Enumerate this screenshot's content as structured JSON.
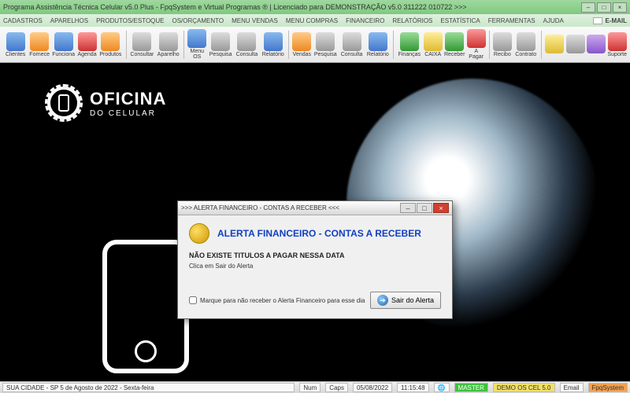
{
  "titlebar": {
    "text": "Programa Assistência Técnica Celular v5.0 Plus - FpqSystem e Virtual Programas ® | Licenciado para  DEMONSTRAÇÃO v5.0 311222 010722 >>>"
  },
  "menu": {
    "items": [
      "CADASTROS",
      "APARELHOS",
      "PRODUTOS/ESTOQUE",
      "OS/ORÇAMENTO",
      "MENU VENDAS",
      "MENU COMPRAS",
      "FINANCEIRO",
      "RELATÓRIOS",
      "ESTATÍSTICA",
      "FERRAMENTAS",
      "AJUDA"
    ],
    "email": "E-MAIL"
  },
  "toolbar": [
    {
      "label": "Clientes",
      "icon": "people-icon",
      "cls": "ic-blue"
    },
    {
      "label": "Fornece",
      "icon": "truck-icon",
      "cls": "ic-orange"
    },
    {
      "label": "Funciona",
      "icon": "person-icon",
      "cls": "ic-blue"
    },
    {
      "label": "Agenda",
      "icon": "calendar-icon",
      "cls": "ic-red"
    },
    {
      "label": "Produtos",
      "icon": "box-icon",
      "cls": "ic-orange",
      "sep": true
    },
    {
      "label": "Consultar",
      "icon": "search-icon",
      "cls": "ic-gray"
    },
    {
      "label": "Aparelho",
      "icon": "phone-icon",
      "cls": "ic-gray",
      "sep": true
    },
    {
      "label": "Menu OS",
      "icon": "clipboard-icon",
      "cls": "ic-blue"
    },
    {
      "label": "Pesquisa",
      "icon": "magnifier-icon",
      "cls": "ic-gray"
    },
    {
      "label": "Consulta",
      "icon": "list-icon",
      "cls": "ic-gray"
    },
    {
      "label": "Relatório",
      "icon": "report-icon",
      "cls": "ic-blue",
      "sep": true
    },
    {
      "label": "Vendas",
      "icon": "cart-icon",
      "cls": "ic-orange"
    },
    {
      "label": "Pesquisa",
      "icon": "magnifier-icon",
      "cls": "ic-gray"
    },
    {
      "label": "Consulta",
      "icon": "list-icon",
      "cls": "ic-gray"
    },
    {
      "label": "Relatório",
      "icon": "report-icon",
      "cls": "ic-blue",
      "sep": true
    },
    {
      "label": "Finanças",
      "icon": "money-icon",
      "cls": "ic-green"
    },
    {
      "label": "CAIXA",
      "icon": "cash-icon",
      "cls": "ic-yellow"
    },
    {
      "label": "Receber",
      "icon": "coin-in-icon",
      "cls": "ic-green"
    },
    {
      "label": "A Pagar",
      "icon": "coin-out-icon",
      "cls": "ic-red",
      "sep": true
    },
    {
      "label": "Recibo",
      "icon": "receipt-icon",
      "cls": "ic-gray"
    },
    {
      "label": "Contrato",
      "icon": "contract-icon",
      "cls": "ic-gray",
      "sep": true
    },
    {
      "label": "",
      "icon": "coin-icon",
      "cls": "ic-yellow"
    },
    {
      "label": "",
      "icon": "doc-icon",
      "cls": "ic-gray"
    },
    {
      "label": "",
      "icon": "tool-icon",
      "cls": "ic-purple"
    },
    {
      "label": "Suporte",
      "icon": "exit-icon",
      "cls": "ic-red"
    }
  ],
  "logo": {
    "line1": "OFICINA",
    "line2": "DO CELULAR"
  },
  "dialog": {
    "title": ">>> ALERTA FINANCEIRO - CONTAS A RECEBER <<<",
    "heading": "ALERTA FINANCEIRO - CONTAS A RECEBER",
    "msg1": "NÃO EXISTE TITULOS A PAGAR NESSA DATA",
    "msg2": "Clica em Sair do Alerta",
    "checkbox": "Marque para não receber o Alerta Financeiro para esse dia",
    "button": "Sair do Alerta"
  },
  "statusbar": {
    "location": "SUA CIDADE - SP  5 de Agosto de 2022 - Sexta-feira",
    "num": "Num",
    "caps": "Caps",
    "date": "05/08/2022",
    "time": "11:15:48",
    "master": "MASTER",
    "demo": "DEMO OS CEL 5.0",
    "email": "Email",
    "fpq": "FpqSystem"
  }
}
